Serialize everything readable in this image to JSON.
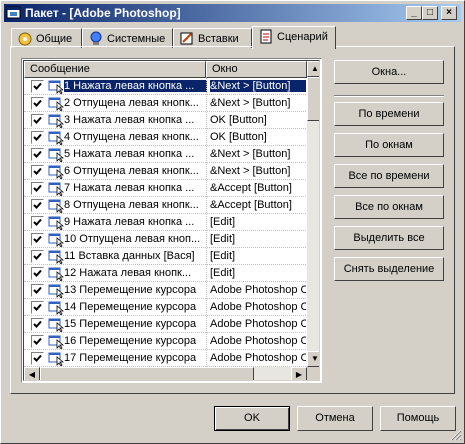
{
  "window": {
    "title": "Пакет - [Adobe Photoshop]",
    "controls": {
      "minimize": "_",
      "maximize": "□",
      "close": "×"
    }
  },
  "tabs": [
    {
      "label": "Общие",
      "icon": "general-icon"
    },
    {
      "label": "Системные",
      "icon": "system-icon"
    },
    {
      "label": "Вставки",
      "icon": "inserts-icon"
    },
    {
      "label": "Сценарий",
      "icon": "script-icon",
      "active": true
    }
  ],
  "list": {
    "columns": [
      "Сообщение",
      "Окно"
    ],
    "rows": [
      {
        "message": "1 Нажата левая кнопка ...",
        "window": "&Next > [Button]",
        "checked": true,
        "selected": true
      },
      {
        "message": "2 Отпущена левая кнопк...",
        "window": "&Next > [Button]",
        "checked": true
      },
      {
        "message": "3 Нажата левая кнопка ...",
        "window": "OK [Button]",
        "checked": true
      },
      {
        "message": "4 Отпущена левая кнопк...",
        "window": "OK [Button]",
        "checked": true
      },
      {
        "message": "5 Нажата левая кнопка ...",
        "window": "&Next > [Button]",
        "checked": true
      },
      {
        "message": "6 Отпущена левая кнопк...",
        "window": "&Next > [Button]",
        "checked": true
      },
      {
        "message": "7 Нажата левая кнопка ...",
        "window": "&Accept [Button]",
        "checked": true
      },
      {
        "message": "8 Отпущена левая кнопк...",
        "window": "&Accept [Button]",
        "checked": true
      },
      {
        "message": "9 Нажата левая кнопка ...",
        "window": " [Edit]",
        "checked": true
      },
      {
        "message": "10 Отпущена левая кноп...",
        "window": " [Edit]",
        "checked": true
      },
      {
        "message": "11 Вставка данных [Вася]",
        "window": " [Edit]",
        "checked": true
      },
      {
        "message": "12 Нажата левая кнопк...",
        "window": " [Edit]",
        "checked": true
      },
      {
        "message": "13 Перемещение курсора",
        "window": "Adobe Photoshop C",
        "checked": true
      },
      {
        "message": "14 Перемещение курсора",
        "window": "Adobe Photoshop C",
        "checked": true
      },
      {
        "message": "15 Перемещение курсора",
        "window": "Adobe Photoshop C",
        "checked": true
      },
      {
        "message": "16 Перемещение курсора",
        "window": "Adobe Photoshop C",
        "checked": true
      },
      {
        "message": "17 Перемещение курсора",
        "window": "Adobe Photoshop C",
        "checked": true
      }
    ]
  },
  "side_buttons": {
    "windows": "Окна...",
    "by_time": "По времени",
    "by_windows": "По окнам",
    "all_by_time": "Все по времени",
    "all_by_windows": "Все по окнам",
    "select_all": "Выделить все",
    "deselect": "Снять выделение"
  },
  "footer": {
    "ok": "OK",
    "cancel": "Отмена",
    "help": "Помощь"
  },
  "colors": {
    "titlebar_start": "#0a246a",
    "titlebar_end": "#a6caf0",
    "selection": "#0a246a",
    "face": "#d4d0c8"
  }
}
